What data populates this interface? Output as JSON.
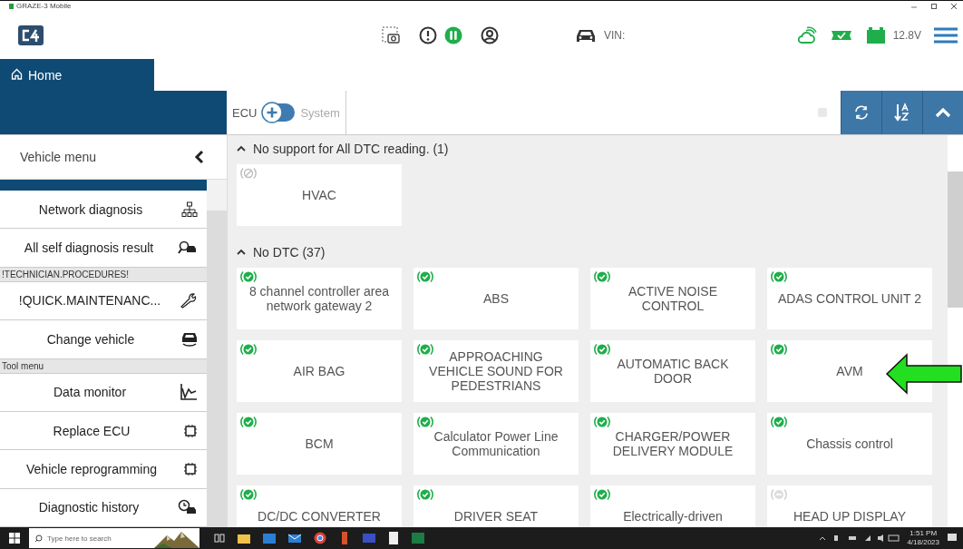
{
  "window": {
    "title": "GRAZE-3 Mobile"
  },
  "header": {
    "vin_label": "VIN:",
    "voltage": "12.8V"
  },
  "home_tab": {
    "label": "Home",
    "selected": true
  },
  "toolbar": {
    "left_label": "ECU",
    "right_label": "System"
  },
  "sidebar": {
    "title": "Vehicle menu",
    "items": [
      {
        "kind": "item",
        "label": "Network diagnosis"
      },
      {
        "kind": "item",
        "label": "All self diagnosis result"
      },
      {
        "kind": "section",
        "label": "!TECHNICIAN.PROCEDURES!"
      },
      {
        "kind": "item",
        "label": "!QUICK.MAINTENANC..."
      },
      {
        "kind": "item",
        "label": "Change vehicle"
      },
      {
        "kind": "section",
        "label": "Tool menu"
      },
      {
        "kind": "item",
        "label": "Data monitor"
      },
      {
        "kind": "item",
        "label": "Replace ECU"
      },
      {
        "kind": "item",
        "label": "Vehicle reprogramming"
      },
      {
        "kind": "item",
        "label": "Diagnostic history"
      }
    ]
  },
  "groups": [
    {
      "title": "No support for All DTC reading. (1)",
      "expanded": true,
      "modules": [
        {
          "name": "HVAC",
          "kind": "unsupported"
        }
      ]
    },
    {
      "title": "No DTC (37)",
      "expanded": true,
      "modules": [
        {
          "name": "8 channel controller area network gateway 2",
          "kind": "ok"
        },
        {
          "name": "ABS",
          "kind": "ok"
        },
        {
          "name": "ACTIVE NOISE CONTROL",
          "kind": "ok"
        },
        {
          "name": "ADAS CONTROL UNIT 2",
          "kind": "ok"
        },
        {
          "name": "AIR BAG",
          "kind": "ok"
        },
        {
          "name": "APPROACHING VEHICLE SOUND FOR PEDESTRIANS",
          "kind": "ok"
        },
        {
          "name": "AUTOMATIC BACK DOOR",
          "kind": "ok"
        },
        {
          "name": "AVM",
          "kind": "ok"
        },
        {
          "name": "BCM",
          "kind": "ok"
        },
        {
          "name": "Calculator Power Line Communication",
          "kind": "ok"
        },
        {
          "name": "CHARGER/POWER DELIVERY MODULE",
          "kind": "ok"
        },
        {
          "name": "Chassis control",
          "kind": "ok"
        },
        {
          "name": "DC/DC CONVERTER",
          "kind": "ok"
        },
        {
          "name": "DRIVER SEAT",
          "kind": "ok"
        },
        {
          "name": "Electrically-driven",
          "kind": "ok"
        },
        {
          "name": "HEAD UP DISPLAY",
          "kind": "unknown"
        }
      ]
    }
  ],
  "taskbar": {
    "search_placeholder": "Type here to search",
    "time": "1:51 PM",
    "date": "4/18/2023"
  }
}
